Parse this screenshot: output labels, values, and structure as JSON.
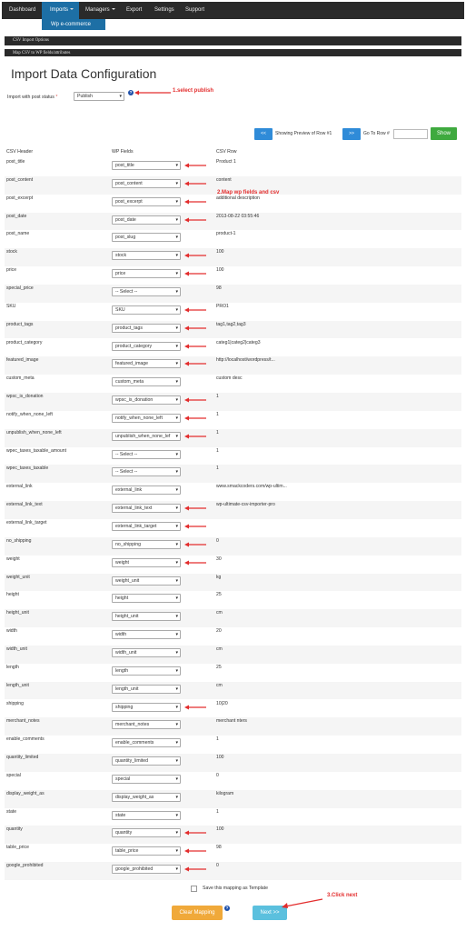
{
  "nav": {
    "items": [
      {
        "label": "Dashboard"
      },
      {
        "label": "Imports"
      },
      {
        "label": "Managers"
      },
      {
        "label": "Export"
      },
      {
        "label": "Settings"
      },
      {
        "label": "Support"
      }
    ],
    "dropdown_item": "Wp e-commerce"
  },
  "bars": {
    "csv_import_options": "CSV Import Options",
    "map_csv": "Map CSV to WP fields/attributes"
  },
  "config": {
    "title": "Import Data Configuration",
    "post_status_label": "Import with post status",
    "required_mark": "*",
    "post_status_value": "Publish",
    "help": "?"
  },
  "annotations": {
    "step1": "1.select publish",
    "step2": "2.Map wp fields and csv",
    "step3": "3.Click next"
  },
  "preview": {
    "prev_label": "<<",
    "next_label": ">>",
    "showing_text": "Showing Preview of Row #1",
    "goto_label": "Go To Row #",
    "goto_value": "",
    "show_label": "Show"
  },
  "columns": {
    "csv_header": "CSV Header",
    "wp_fields": "WP Fields",
    "csv_row": "CSV Row"
  },
  "rows": [
    {
      "csv": "post_title",
      "wp": "post_title",
      "value": "Product 1",
      "arrow": true
    },
    {
      "csv": "post_content",
      "wp": "post_content",
      "value": "content",
      "arrow": true
    },
    {
      "csv": "post_excerpt",
      "wp": "post_excerpt",
      "value": "additional description",
      "arrow": true
    },
    {
      "csv": "post_date",
      "wp": "post_date",
      "value": "2013-08-22 03:55:46",
      "arrow": true
    },
    {
      "csv": "post_name",
      "wp": "post_slug",
      "value": "product-1",
      "arrow": false
    },
    {
      "csv": "stock",
      "wp": "stock",
      "value": "100",
      "arrow": true
    },
    {
      "csv": "price",
      "wp": "price",
      "value": "100",
      "arrow": true
    },
    {
      "csv": "special_price",
      "wp": "-- Select --",
      "value": "98",
      "arrow": false
    },
    {
      "csv": "SKU",
      "wp": "SKU",
      "value": "PRO1",
      "arrow": true
    },
    {
      "csv": "product_tags",
      "wp": "product_tags",
      "value": "tag1,tag2,tag3",
      "arrow": true
    },
    {
      "csv": "product_category",
      "wp": "product_category",
      "value": "categ1|categ2|categ3",
      "arrow": true
    },
    {
      "csv": "featured_image",
      "wp": "featured_image",
      "value": "http://localhost/wordpress/t...",
      "arrow": true
    },
    {
      "csv": "custom_meta",
      "wp": "custom_meta",
      "value": "custom desc",
      "arrow": false
    },
    {
      "csv": "wpsc_is_donation",
      "wp": "wpsc_is_donation",
      "value": "1",
      "arrow": true
    },
    {
      "csv": "notify_when_none_left",
      "wp": "notify_when_none_left",
      "value": "1",
      "arrow": true
    },
    {
      "csv": "unpublish_when_none_left",
      "wp": "unpublish_when_none_lef",
      "value": "1",
      "arrow": true
    },
    {
      "csv": "wpec_taxes_taxable_amount",
      "wp": "-- Select --",
      "value": "1",
      "arrow": false
    },
    {
      "csv": "wpec_taxes_taxable",
      "wp": "-- Select --",
      "value": "1",
      "arrow": false
    },
    {
      "csv": "external_link",
      "wp": "external_link",
      "value": "www.smackcoders.com/wp-ultim...",
      "arrow": false
    },
    {
      "csv": "external_link_text",
      "wp": "external_link_text",
      "value": "wp-ultimate-csv-importer-pro",
      "arrow": true
    },
    {
      "csv": "external_link_target",
      "wp": "external_link_target",
      "value": "",
      "arrow": true
    },
    {
      "csv": "no_shipping",
      "wp": "no_shipping",
      "value": "0",
      "arrow": true
    },
    {
      "csv": "weight",
      "wp": "weight",
      "value": "30",
      "arrow": true
    },
    {
      "csv": "weight_unit",
      "wp": "weight_unit",
      "value": "kg",
      "arrow": false
    },
    {
      "csv": "height",
      "wp": "height",
      "value": "25",
      "arrow": false
    },
    {
      "csv": "height_unit",
      "wp": "height_unit",
      "value": "cm",
      "arrow": false
    },
    {
      "csv": "width",
      "wp": "width",
      "value": "20",
      "arrow": false
    },
    {
      "csv": "width_unit",
      "wp": "width_unit",
      "value": "cm",
      "arrow": false
    },
    {
      "csv": "length",
      "wp": "length",
      "value": "25",
      "arrow": false
    },
    {
      "csv": "length_unit",
      "wp": "length_unit",
      "value": "cm",
      "arrow": false
    },
    {
      "csv": "shipping",
      "wp": "shipping",
      "value": "10|20",
      "arrow": true
    },
    {
      "csv": "merchant_notes",
      "wp": "merchant_notes",
      "value": "merchant nters",
      "arrow": false
    },
    {
      "csv": "enable_comments",
      "wp": "enable_comments",
      "value": "1",
      "arrow": false
    },
    {
      "csv": "quantity_limited",
      "wp": "quantity_limited",
      "value": "100",
      "arrow": false
    },
    {
      "csv": "special",
      "wp": "special",
      "value": "0",
      "arrow": false
    },
    {
      "csv": "display_weight_as",
      "wp": "display_weight_as",
      "value": "kilogram",
      "arrow": false
    },
    {
      "csv": "state",
      "wp": "state",
      "value": "1",
      "arrow": false
    },
    {
      "csv": "quantity",
      "wp": "quantity",
      "value": "100",
      "arrow": true
    },
    {
      "csv": "table_price",
      "wp": "table_price",
      "value": "98",
      "arrow": true
    },
    {
      "csv": "google_prohibited",
      "wp": "google_prohibited",
      "value": "0",
      "arrow": true
    }
  ],
  "footer": {
    "save_mapping_label": "Save this mapping as Template",
    "clear_mapping": "Clear Mapping",
    "next": "Next >>"
  },
  "colors": {
    "nav_bg": "#2a2a2a",
    "nav_active": "#1d6fa5",
    "annotation": "#e32d2d",
    "blue_button": "#2f8bd8",
    "green_button": "#3faa3f",
    "orange_button": "#f0a93a",
    "next_button": "#5bc0de"
  }
}
